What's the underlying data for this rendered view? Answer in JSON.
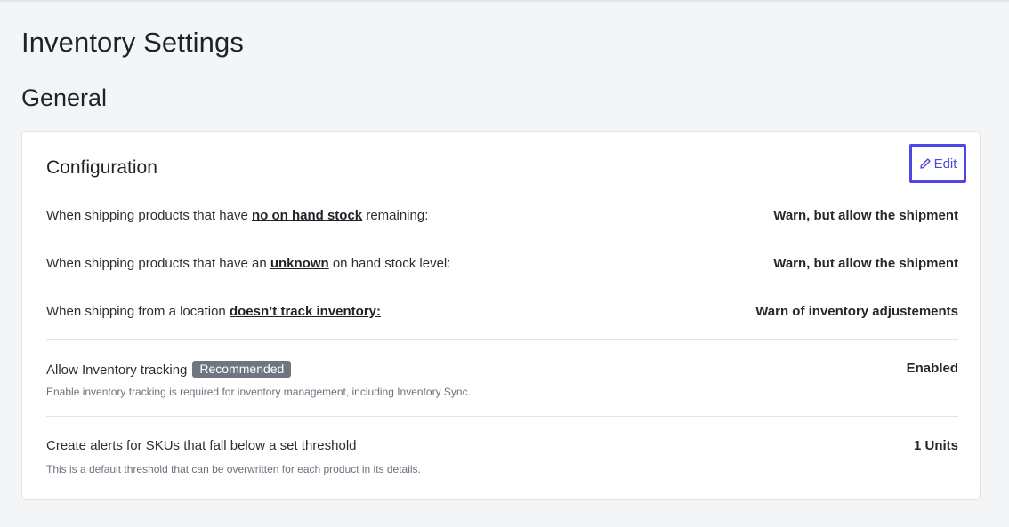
{
  "page": {
    "title": "Inventory Settings",
    "section_title": "General"
  },
  "card": {
    "title": "Configuration",
    "edit": {
      "label": "Edit",
      "icon": "pencil-icon",
      "accent_color": "#4f46e5"
    },
    "rows": [
      {
        "label_prefix": "When shipping products that have ",
        "label_emphasis": "no on hand stock",
        "label_suffix": " remaining:",
        "value": "Warn, but allow the shipment"
      },
      {
        "label_prefix": "When shipping products that have an ",
        "label_emphasis": "unknown",
        "label_suffix": " on hand stock level:",
        "value": "Warn, but allow the shipment"
      },
      {
        "label_prefix": "When shipping from a location ",
        "label_emphasis": "doesn’t track inventory:",
        "label_suffix": "",
        "value": "Warn of inventory adjustements"
      }
    ],
    "tracking": {
      "label": "Allow Inventory tracking",
      "badge": "Recommended",
      "hint": "Enable inventory tracking is required for inventory management, including Inventory Sync.",
      "value": "Enabled"
    },
    "alerts": {
      "label": "Create alerts for SKUs that fall below a set threshold",
      "hint": "This is a default threshold that can be overwritten for each product in its details.",
      "value": "1 Units"
    }
  }
}
